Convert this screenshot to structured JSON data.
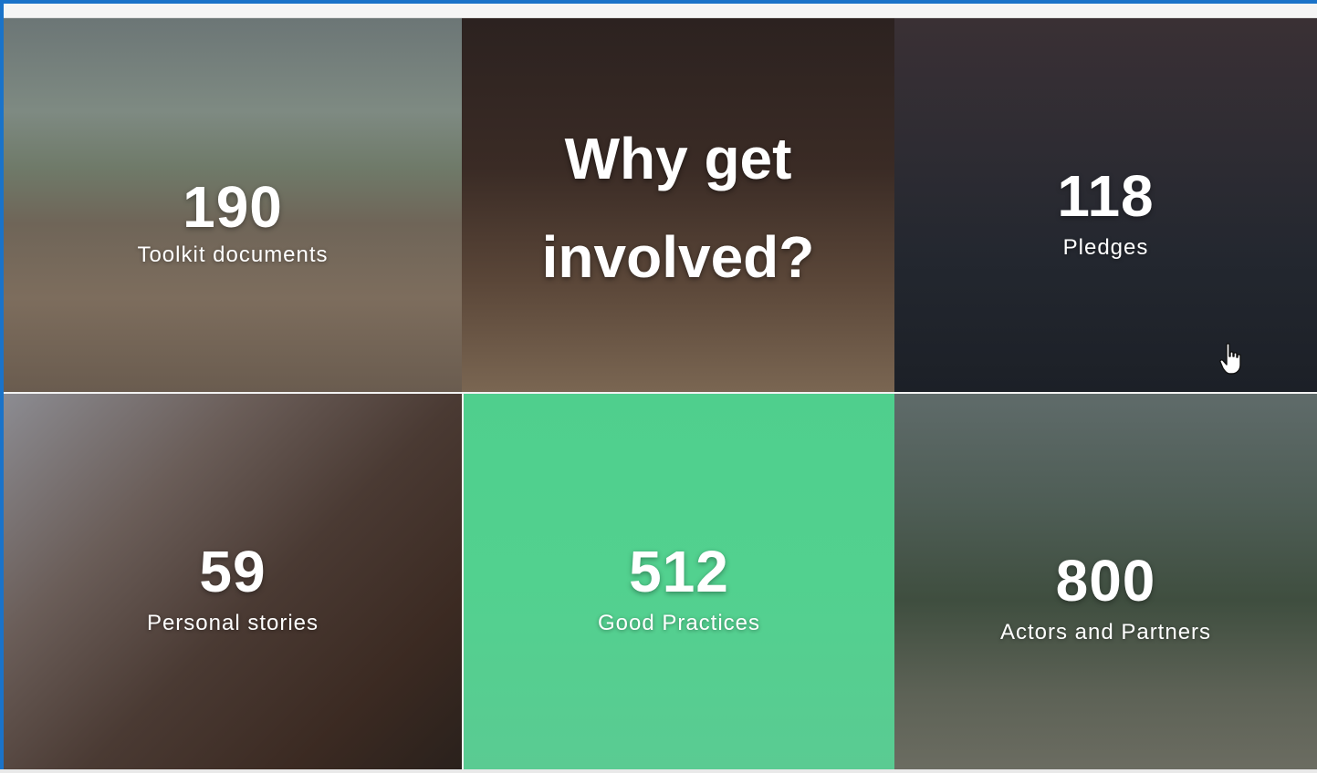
{
  "headline": {
    "line1": "Why get",
    "line2": "involved?"
  },
  "stats": [
    {
      "count": "190",
      "label": "Toolkit documents"
    },
    {
      "count": "118",
      "label": "Pledges"
    },
    {
      "count": "59",
      "label": "Personal stories"
    },
    {
      "count": "512",
      "label": "Good Practices"
    },
    {
      "count": "800",
      "label": "Actors and Partners"
    }
  ],
  "colors": {
    "accent_green": "#52d18f",
    "frame_blue": "#1a73c9",
    "text": "#ffffff"
  },
  "icons": {
    "cursor": "hand-pointer-icon"
  }
}
